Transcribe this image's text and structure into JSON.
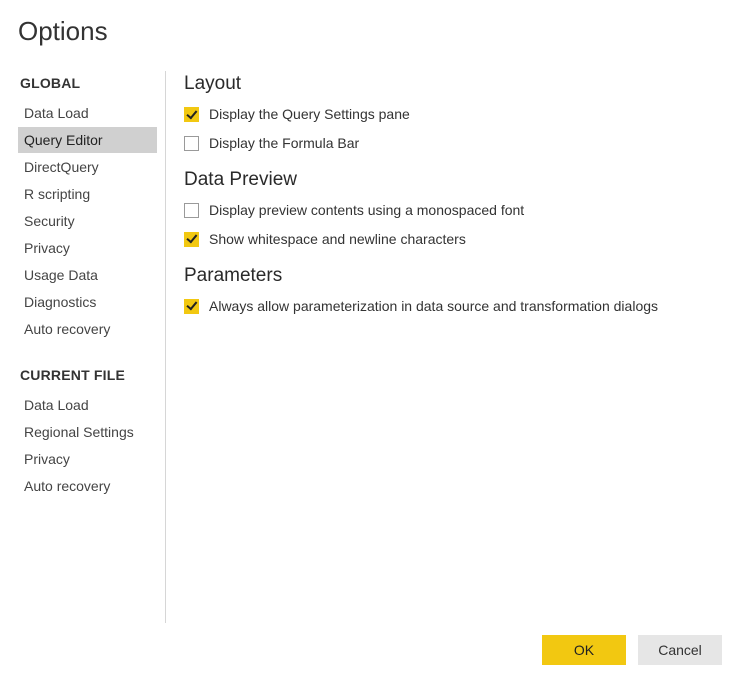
{
  "title": "Options",
  "sidebar": {
    "groups": [
      {
        "header": "GLOBAL",
        "items": [
          {
            "label": "Data Load",
            "selected": false
          },
          {
            "label": "Query Editor",
            "selected": true
          },
          {
            "label": "DirectQuery",
            "selected": false
          },
          {
            "label": "R scripting",
            "selected": false
          },
          {
            "label": "Security",
            "selected": false
          },
          {
            "label": "Privacy",
            "selected": false
          },
          {
            "label": "Usage Data",
            "selected": false
          },
          {
            "label": "Diagnostics",
            "selected": false
          },
          {
            "label": "Auto recovery",
            "selected": false
          }
        ]
      },
      {
        "header": "CURRENT FILE",
        "items": [
          {
            "label": "Data Load",
            "selected": false
          },
          {
            "label": "Regional Settings",
            "selected": false
          },
          {
            "label": "Privacy",
            "selected": false
          },
          {
            "label": "Auto recovery",
            "selected": false
          }
        ]
      }
    ]
  },
  "content": {
    "sections": [
      {
        "title": "Layout",
        "options": [
          {
            "label": "Display the Query Settings pane",
            "checked": true
          },
          {
            "label": "Display the Formula Bar",
            "checked": false
          }
        ]
      },
      {
        "title": "Data Preview",
        "options": [
          {
            "label": "Display preview contents using a monospaced font",
            "checked": false
          },
          {
            "label": "Show whitespace and newline characters",
            "checked": true
          }
        ]
      },
      {
        "title": "Parameters",
        "options": [
          {
            "label": "Always allow parameterization in data source and transformation dialogs",
            "checked": true
          }
        ]
      }
    ]
  },
  "footer": {
    "ok": "OK",
    "cancel": "Cancel"
  },
  "colors": {
    "accent": "#f2c811"
  }
}
